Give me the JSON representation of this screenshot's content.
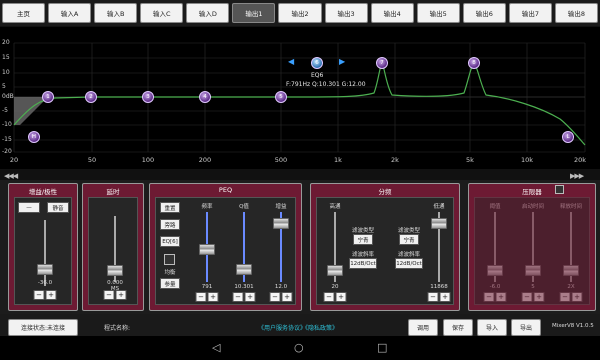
{
  "tabs": [
    "主页",
    "输入A",
    "输入B",
    "输入C",
    "输入D",
    "输出1",
    "输出2",
    "输出3",
    "输出4",
    "输出5",
    "输出6",
    "输出7",
    "输出8"
  ],
  "active_tab": 5,
  "graph": {
    "y_labels": [
      "20",
      "15",
      "10",
      "5",
      "0dB",
      "-5",
      "-10",
      "-15",
      "-20"
    ],
    "x_labels": [
      "20",
      "50",
      "100",
      "200",
      "500",
      "1k",
      "2k",
      "5k",
      "10k",
      "20k"
    ],
    "selected_band": "EQ6",
    "selected_info": "F:791Hz Q:10.301 G:12.00",
    "nodes": [
      "H",
      "1",
      "2",
      "3",
      "4",
      "5",
      "6",
      "7",
      "8",
      "L"
    ]
  },
  "chevrons_left": "◀◀◀",
  "chevrons_right": "▶▶▶",
  "gain": {
    "title": "增益/极性",
    "phase_label": "—",
    "mute_label": "静音",
    "value": "-36.0",
    "level": 0.35
  },
  "delay": {
    "title": "延时",
    "value": "0.000 MS",
    "level": 0.0
  },
  "peq": {
    "title": "PEQ",
    "buttons": [
      "重置",
      "旁路",
      "EQ[6]",
      "均衡",
      "参量"
    ],
    "col_labels": [
      "频率",
      "Q值",
      "增益"
    ],
    "values": [
      "791",
      "10.301",
      "12.0"
    ]
  },
  "crossover": {
    "title": "分频",
    "hp_label": "高通",
    "lp_label": "低通",
    "hp_value": "20",
    "lp_value": "11868",
    "type_label": "滤波类型",
    "type_value_hp": "宁青",
    "type_value_lp": "宁青",
    "slope_label": "滤波斜率",
    "slope_value_hp": "12dB/Oct",
    "slope_value_lp": "12dB/Oct"
  },
  "compressor": {
    "title": "压限器",
    "labels": [
      "阈值",
      "启动时间",
      "释放时间"
    ],
    "values": [
      "-6.0",
      "5",
      "2X"
    ]
  },
  "bottom": {
    "connection_status": "连接状态:未连接",
    "program_name_label": "程式名称:",
    "user_agreement": "《用户服务协议》",
    "privacy_policy": "《隐私政策》",
    "buttons": [
      "调用",
      "保存",
      "导入",
      "导出"
    ],
    "version": "MixerV8 V1.0.5"
  },
  "colors": {
    "panel": "#6d1a33",
    "curve": "#4caf50",
    "accent": "#3aa0ff"
  }
}
